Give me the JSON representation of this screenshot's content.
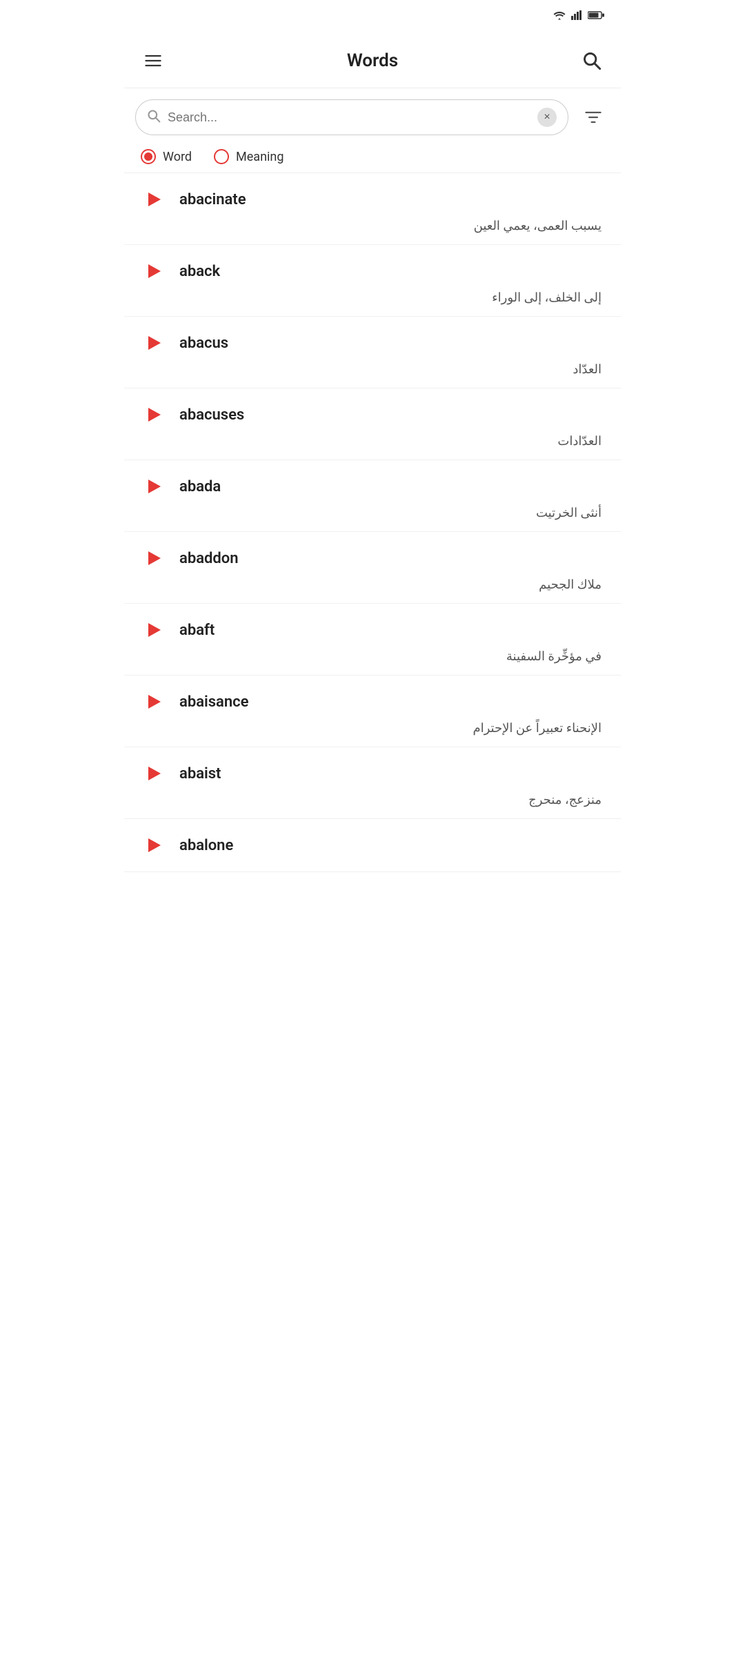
{
  "statusBar": {
    "battery": "🔋",
    "signal": "📶"
  },
  "header": {
    "title": "Words",
    "menuIcon": "menu-icon",
    "searchIcon": "search-icon"
  },
  "searchBar": {
    "placeholder": "Search...",
    "clearLabel": "×",
    "filterIcon": "filter-icon"
  },
  "filterOptions": [
    {
      "id": "word",
      "label": "Word",
      "selected": true
    },
    {
      "id": "meaning",
      "label": "Meaning",
      "selected": false
    }
  ],
  "words": [
    {
      "word": "abacinate",
      "meaning": "يسبب العمى، يعمي العين"
    },
    {
      "word": "aback",
      "meaning": "إلى الخلف، إلى الوراء"
    },
    {
      "word": "abacus",
      "meaning": "العدّاد"
    },
    {
      "word": "abacuses",
      "meaning": "العدّادات"
    },
    {
      "word": "abada",
      "meaning": "أنثى الخرتيت"
    },
    {
      "word": "abaddon",
      "meaning": "ملاك الجحيم"
    },
    {
      "word": "abaft",
      "meaning": "في مؤخِّرة السفينة"
    },
    {
      "word": "abaisance",
      "meaning": "الإنحناء تعبيراً عن الإحترام"
    },
    {
      "word": "abaist",
      "meaning": "منزعج، منحرج"
    },
    {
      "word": "abalone",
      "meaning": ""
    }
  ]
}
